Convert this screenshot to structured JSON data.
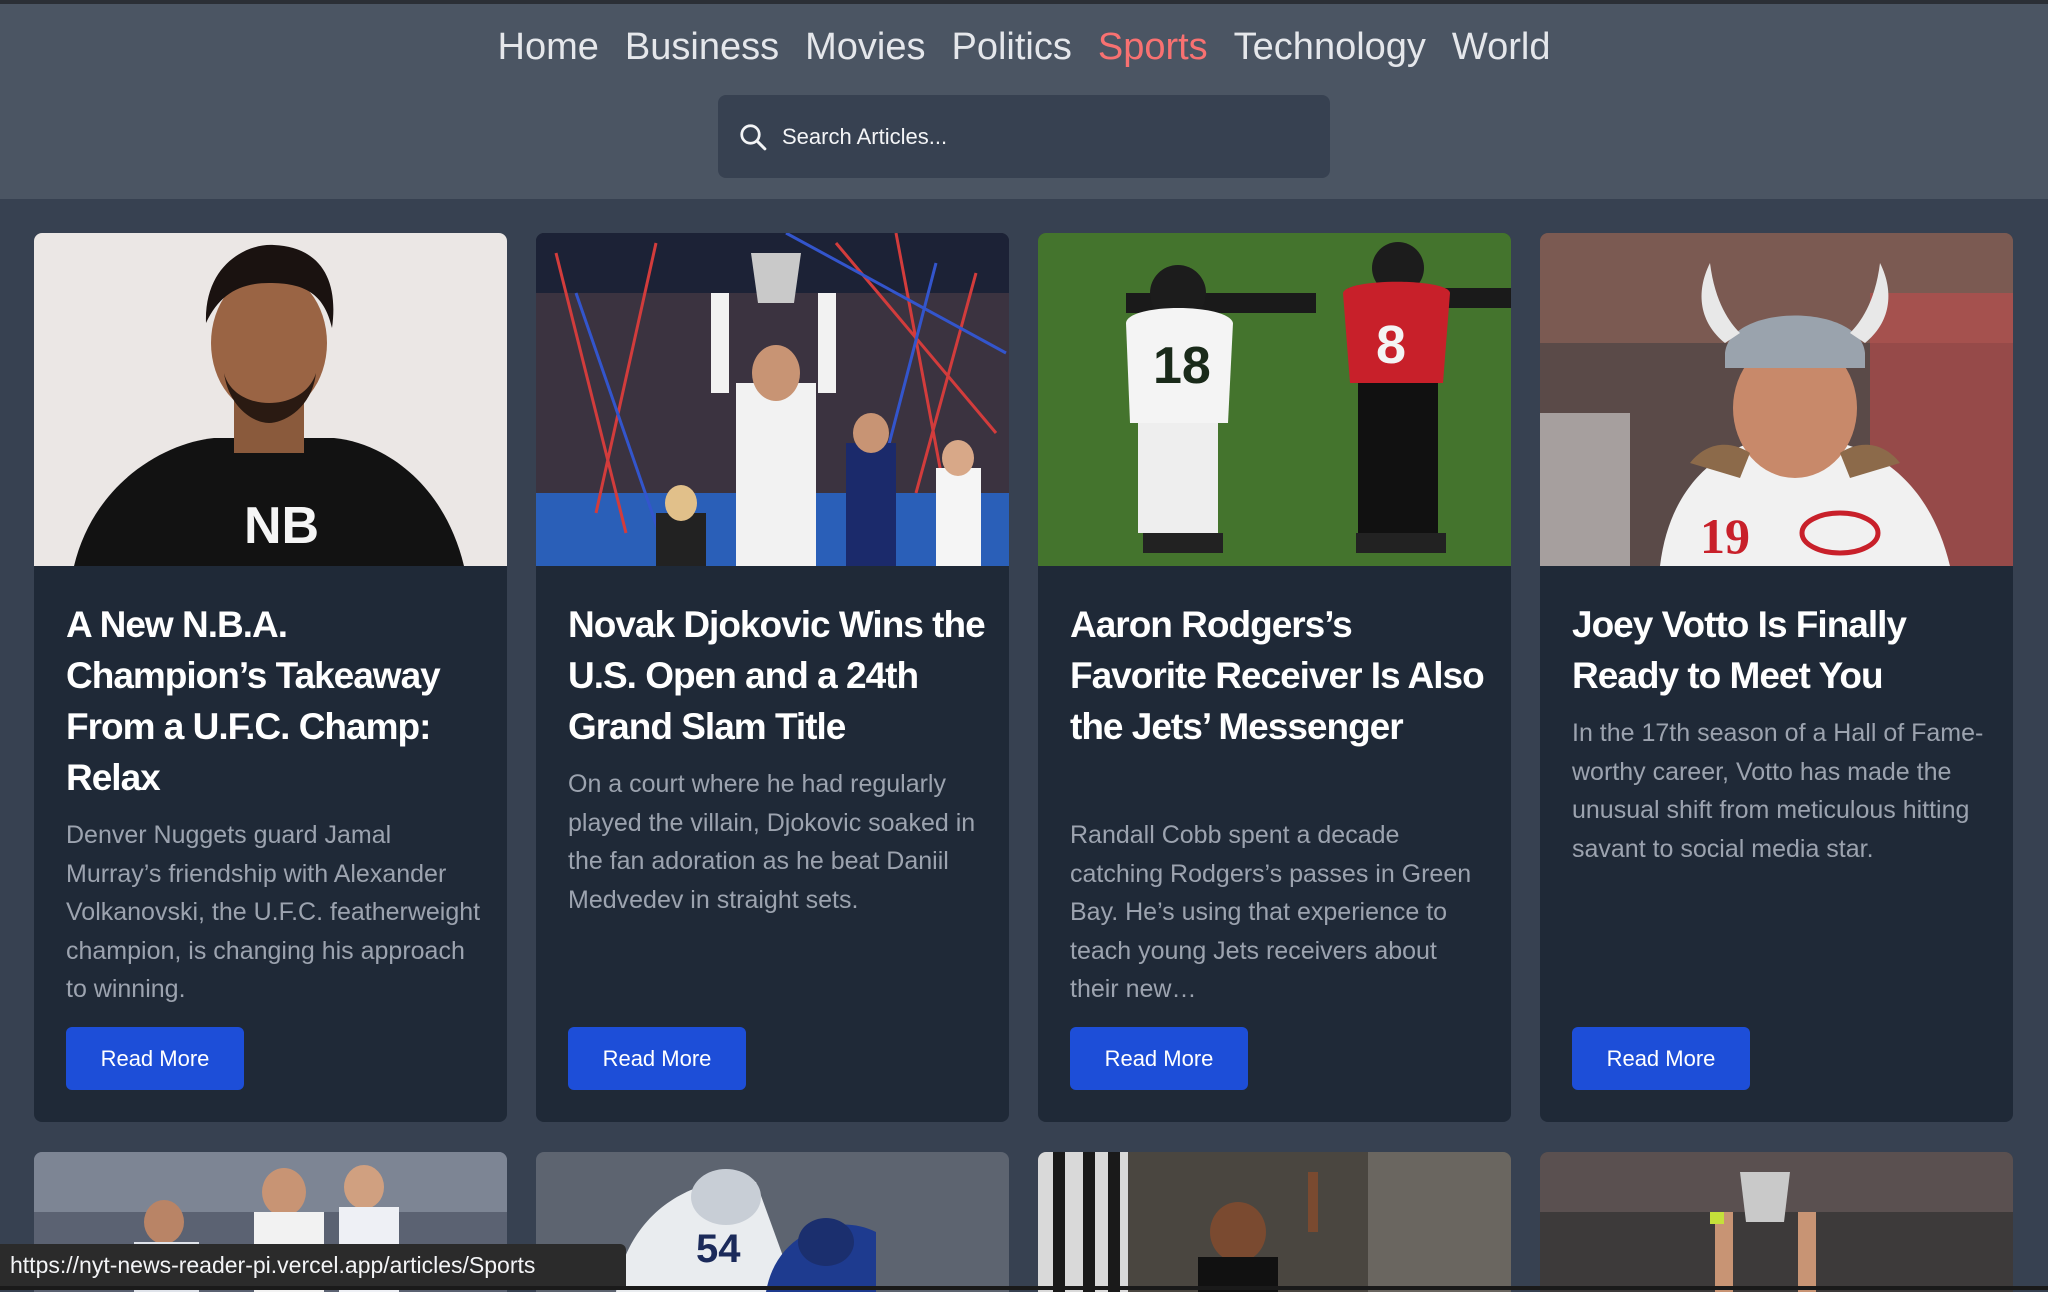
{
  "nav": {
    "items": [
      "Home",
      "Business",
      "Movies",
      "Politics",
      "Sports",
      "Technology",
      "World"
    ],
    "active": "Sports",
    "active_color": "#f87171"
  },
  "search": {
    "placeholder": "Search Articles..."
  },
  "articles": [
    {
      "title": "A New N.B.A. Champion’s Takeaway From a U.F.C. Champ: Relax",
      "abstract": "Denver Nuggets guard Jamal Murray’s friendship with Alexander Volkanovski, the U.F.C. featherweight champion, is changing his approach to winning.",
      "button": "Read More"
    },
    {
      "title": "Novak Djokovic Wins the U.S. Open and a 24th Grand Slam Title",
      "abstract": "On a court where he had regularly played the villain, Djokovic soaked in the fan adoration as he beat Daniil Medvedev in straight sets.",
      "button": "Read More"
    },
    {
      "title": "Aaron Rodgers’s Favorite Receiver Is Also the Jets’ Messenger",
      "abstract": "Randall Cobb spent a decade catching Rodgers’s passes in Green Bay. He’s using that experience to teach young Jets receivers about their new…",
      "button": "Read More"
    },
    {
      "title": "Joey Votto Is Finally Ready to Meet You",
      "abstract": "In the 17th season of a Hall of Fame-worthy career, Votto has made the unusual shift from meticulous hitting savant to social media star.",
      "button": "Read More"
    }
  ],
  "status_url": "https://nyt-news-reader-pi.vercel.app/articles/Sports",
  "colors": {
    "header_bg": "#4b5563",
    "page_bg": "#374151",
    "card_bg": "#1f2937",
    "button_bg": "#1d4ed8"
  }
}
